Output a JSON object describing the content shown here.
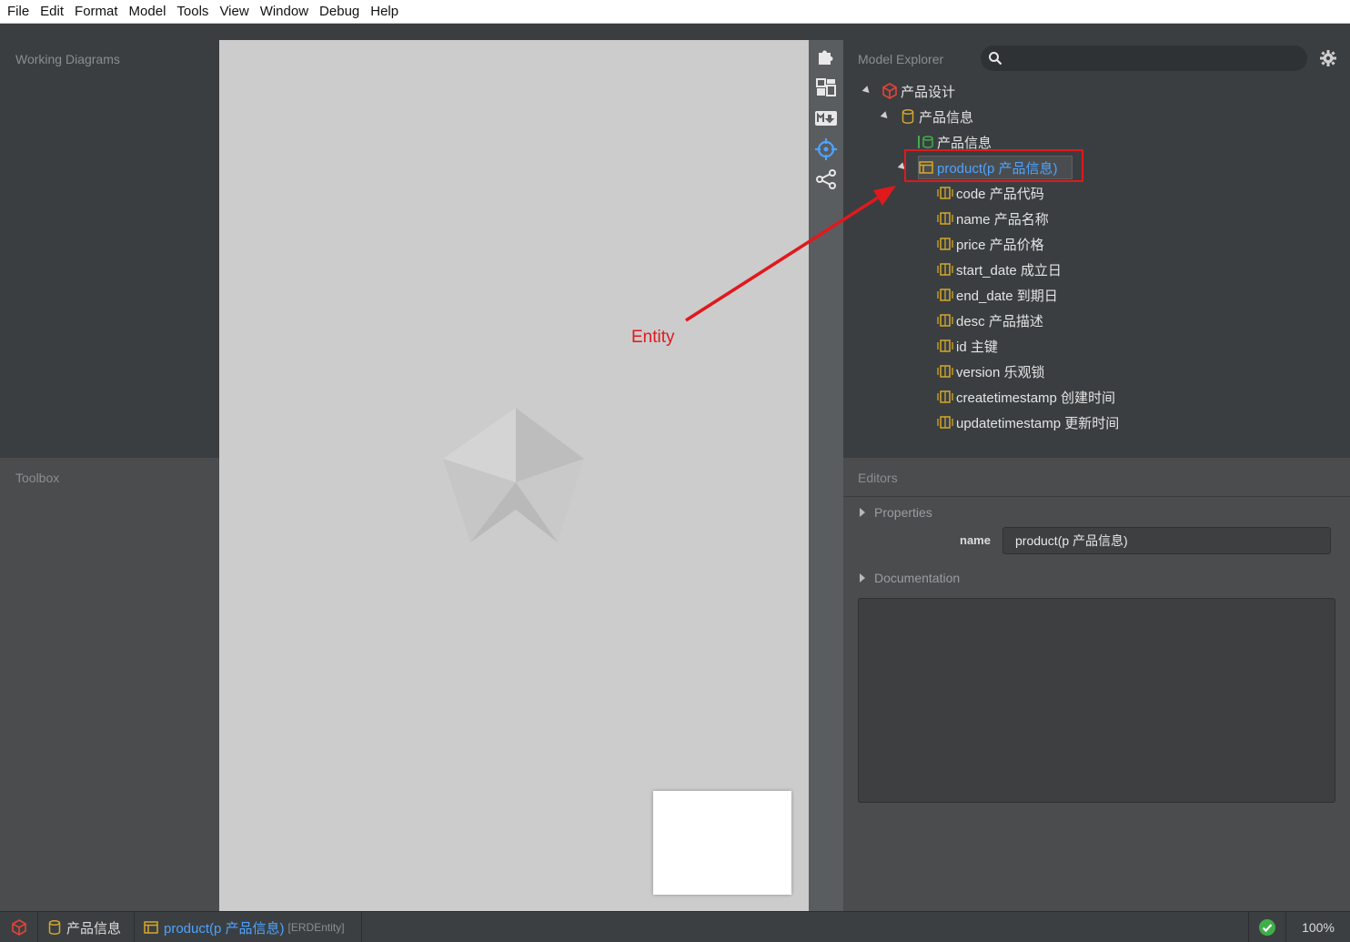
{
  "menu": [
    "File",
    "Edit",
    "Format",
    "Model",
    "Tools",
    "View",
    "Window",
    "Debug",
    "Help"
  ],
  "panels": {
    "working_diagrams": "Working Diagrams",
    "toolbox": "Toolbox",
    "model_explorer": "Model Explorer",
    "editors": "Editors"
  },
  "tree": {
    "project": "产品设计",
    "datamodel": "产品信息",
    "diagram": "产品信息",
    "entity": "product(p 产品信息)",
    "columns": [
      "code 产品代码",
      "name 产品名称",
      "price 产品价格",
      "start_date 成立日",
      "end_date 到期日",
      "desc 产品描述",
      "id 主键",
      "version 乐观锁",
      "createtimestamp 创建时间",
      "updatetimestamp 更新时间"
    ]
  },
  "editors": {
    "properties_label": "Properties",
    "name_label": "name",
    "name_value": "product(p 产品信息)",
    "documentation_label": "Documentation"
  },
  "statusbar": {
    "datamodel": "产品信息",
    "entity": "product(p 产品信息)",
    "entity_type": "[ERDEntity]",
    "zoom": "100%"
  },
  "annotation": {
    "label": "Entity"
  },
  "colors": {
    "annotation_red": "#e0191d",
    "selection_blue": "#4da3ff",
    "entity_icon": "#d4a72c",
    "diagram_icon": "#3fae49",
    "project_icon": "#e2443a",
    "status_ok": "#3fae49"
  }
}
